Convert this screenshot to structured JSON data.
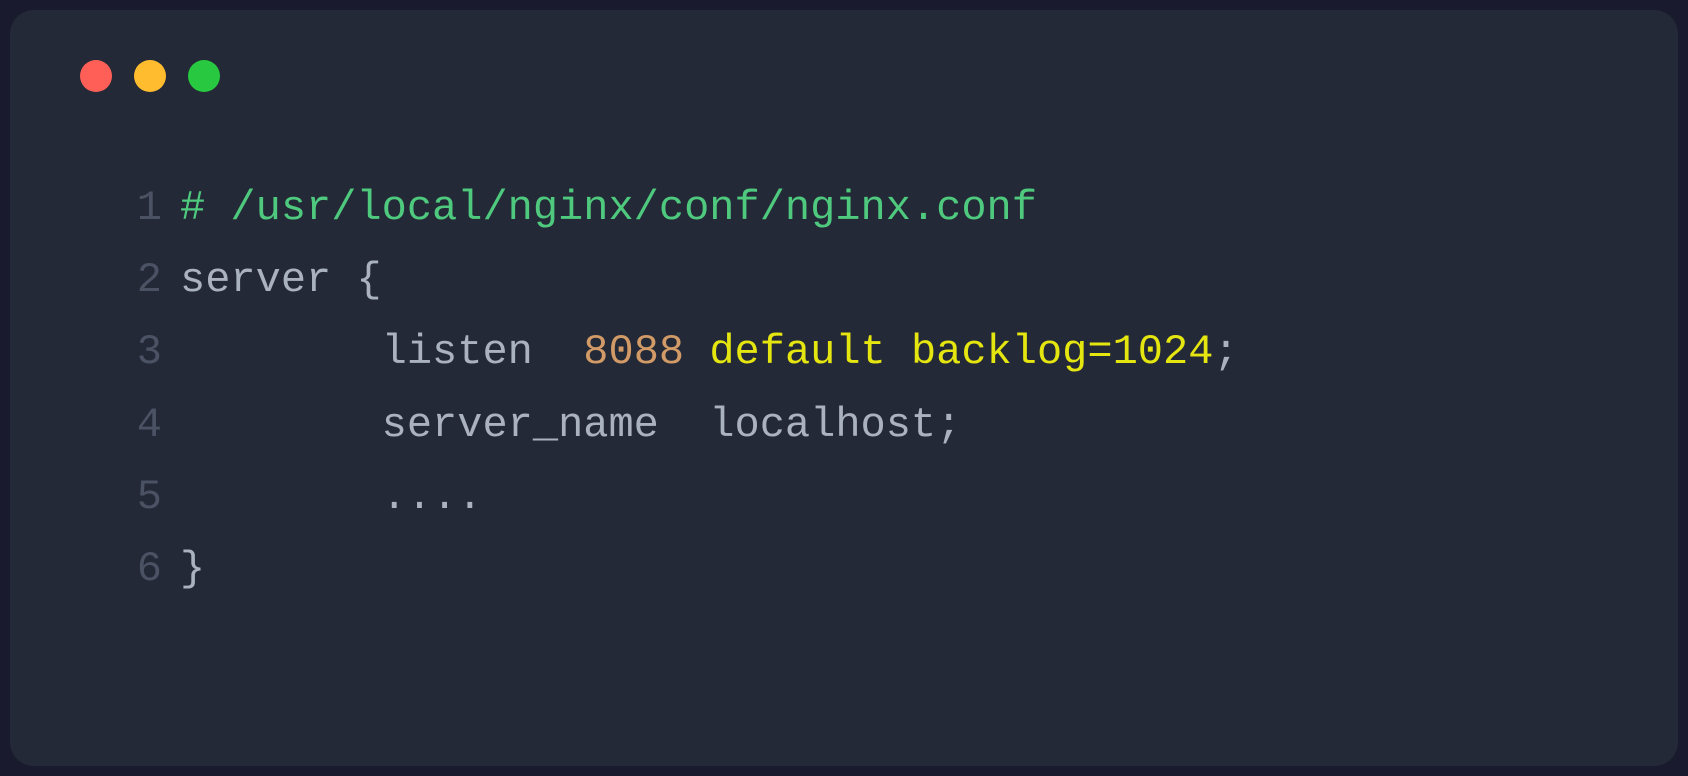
{
  "editor": {
    "lines": [
      {
        "number": "1",
        "tokens": {
          "comment": "# /usr/local/nginx/conf/nginx.conf"
        }
      },
      {
        "number": "2",
        "tokens": {
          "text": "server {"
        }
      },
      {
        "number": "3",
        "tokens": {
          "indent": "        ",
          "directive": "listen  ",
          "port": "8088",
          "space": " ",
          "params": "default backlog=1024",
          "semi": ";"
        }
      },
      {
        "number": "4",
        "tokens": {
          "indent": "        ",
          "text": "server_name  localhost;"
        }
      },
      {
        "number": "5",
        "tokens": {
          "indent": "        ",
          "text": "...."
        }
      },
      {
        "number": "6",
        "tokens": {
          "text": "}"
        }
      }
    ]
  }
}
